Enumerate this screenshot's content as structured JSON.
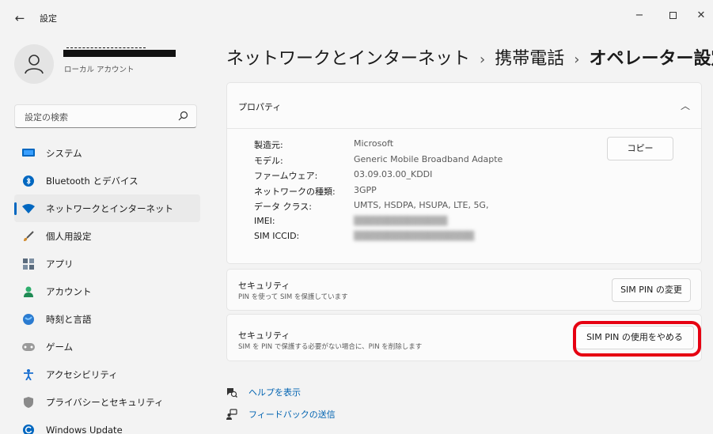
{
  "window": {
    "title": "設定",
    "back_icon": "back-arrow-icon",
    "controls": [
      "minimize",
      "maximize",
      "close"
    ]
  },
  "account": {
    "type_label": "ローカル アカウント"
  },
  "search": {
    "placeholder": "設定の検索"
  },
  "sidebar": {
    "items": [
      {
        "label": "システム",
        "icon": "system-icon",
        "color": "#0067c0"
      },
      {
        "label": "Bluetooth とデバイス",
        "icon": "bluetooth-icon",
        "color": "#0067c0"
      },
      {
        "label": "ネットワークとインターネット",
        "icon": "network-icon",
        "color": "#0067c0",
        "selected": true
      },
      {
        "label": "個人用設定",
        "icon": "personalization-icon",
        "color": "#d08a2c"
      },
      {
        "label": "アプリ",
        "icon": "apps-icon",
        "color": "#5a6b7d"
      },
      {
        "label": "アカウント",
        "icon": "account-icon",
        "color": "#2eae6d"
      },
      {
        "label": "時刻と言語",
        "icon": "time-language-icon",
        "color": "#2b7bd0"
      },
      {
        "label": "ゲーム",
        "icon": "gaming-icon",
        "color": "#8a8a8a"
      },
      {
        "label": "アクセシビリティ",
        "icon": "accessibility-icon",
        "color": "#1a6fd0"
      },
      {
        "label": "プライバシーとセキュリティ",
        "icon": "privacy-shield-icon",
        "color": "#7a7a7a"
      },
      {
        "label": "Windows Update",
        "icon": "windows-update-icon",
        "color": "#0067c0"
      }
    ]
  },
  "header": {
    "breadcrumb": [
      "ネットワークとインターネット",
      "携帯電話",
      "オペレーター設定"
    ],
    "separator": "›"
  },
  "properties": {
    "title": "プロパティ",
    "copy_label": "コピー",
    "rows": [
      {
        "key": "製造元:",
        "value": "Microsoft"
      },
      {
        "key": "モデル:",
        "value": "Generic Mobile Broadband Adapte"
      },
      {
        "key": "ファームウェア:",
        "value": "03.09.03.00_KDDI"
      },
      {
        "key": "ネットワークの種類:",
        "value": "3GPP"
      },
      {
        "key": "データ クラス:",
        "value": "UMTS, HSDPA, HSUPA, LTE, 5G,"
      },
      {
        "key": "IMEI:",
        "value": "",
        "blurred": true
      },
      {
        "key": "SIM ICCID:",
        "value": "",
        "blurred": true
      }
    ]
  },
  "security_change": {
    "title": "セキュリティ",
    "description": "PIN を使って SIM を保護しています",
    "button_label": "SIM PIN の変更"
  },
  "security_remove": {
    "title": "セキュリティ",
    "description": "SIM を PIN で保護する必要がない場合に、PIN を削除します",
    "button_label": "SIM PIN の使用をやめる",
    "highlight_color": "#e60012"
  },
  "links": {
    "help": "ヘルプを表示",
    "feedback": "フィードバックの送信"
  },
  "colors": {
    "accent": "#0067c0",
    "link": "#0063b1",
    "background": "#f3f3f3"
  }
}
